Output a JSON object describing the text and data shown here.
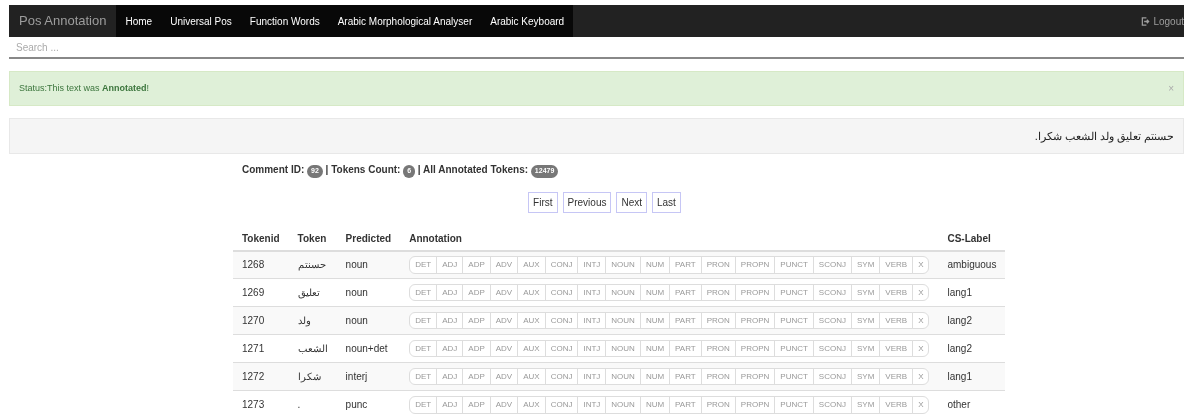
{
  "navbar": {
    "brand": "Pos Annotation",
    "links": [
      {
        "label": "Home"
      },
      {
        "label": "Universal Pos"
      },
      {
        "label": "Function Words"
      },
      {
        "label": "Arabic Morphological Analyser"
      },
      {
        "label": "Arabic Keyboard"
      }
    ],
    "logout": "Logout"
  },
  "search": {
    "placeholder": "Search ..."
  },
  "alert": {
    "text": "Status:This text was **Annotated**!",
    "close": "×"
  },
  "sentence": "حسنتم تعليق ولد الشعب شكرا.",
  "stats": [
    {
      "label": "Comment ID:",
      "value": "92"
    },
    {
      "label": "Tokens Count:",
      "value": "6"
    },
    {
      "label": "All Annotated Tokens:",
      "value": "12479"
    }
  ],
  "separator": "|",
  "pagination": [
    "First",
    "Previous",
    "Next",
    "Last"
  ],
  "table": {
    "columns": [
      "Tokenid",
      "Token",
      "Predicted",
      "Annotation",
      "CS-Label"
    ],
    "rows": [
      {
        "tokenid": "1268",
        "token": "حسنتم",
        "predicted": "noun",
        "tags": [
          {
            "label": "DET",
            "selected": false
          },
          {
            "label": "ADJ",
            "selected": false
          },
          {
            "label": "ADP",
            "selected": false
          },
          {
            "label": "ADV",
            "selected": false
          },
          {
            "label": "AUX",
            "selected": false
          },
          {
            "label": "CONJ",
            "selected": false
          },
          {
            "label": "INTJ",
            "selected": false
          },
          {
            "label": "NOUN",
            "selected": false
          },
          {
            "label": "NUM",
            "selected": false
          },
          {
            "label": "PART",
            "selected": false
          },
          {
            "label": "PRON",
            "selected": false
          },
          {
            "label": "PROPN",
            "selected": false
          },
          {
            "label": "PUNCT",
            "selected": false
          },
          {
            "label": "SCONJ",
            "selected": false
          },
          {
            "label": "SYM",
            "selected": false
          },
          {
            "label": "VERB",
            "selected": false
          },
          {
            "label": "X",
            "selected": false
          }
        ],
        "cs_label": "ambiguous"
      },
      {
        "tokenid": "1269",
        "token": "تعليق",
        "predicted": "noun",
        "tags": [
          {
            "label": "DET",
            "selected": false
          },
          {
            "label": "ADJ",
            "selected": false
          },
          {
            "label": "ADP",
            "selected": false
          },
          {
            "label": "ADV",
            "selected": false
          },
          {
            "label": "AUX",
            "selected": false
          },
          {
            "label": "CONJ",
            "selected": false
          },
          {
            "label": "INTJ",
            "selected": false
          },
          {
            "label": "NOUN",
            "selected": false
          },
          {
            "label": "NUM",
            "selected": false
          },
          {
            "label": "PART",
            "selected": false
          },
          {
            "label": "PRON",
            "selected": false
          },
          {
            "label": "PROPN",
            "selected": false
          },
          {
            "label": "PUNCT",
            "selected": false
          },
          {
            "label": "SCONJ",
            "selected": false
          },
          {
            "label": "SYM",
            "selected": false
          },
          {
            "label": "VERB",
            "selected": false
          },
          {
            "label": "X",
            "selected": false
          }
        ],
        "cs_label": "lang1"
      },
      {
        "tokenid": "1270",
        "token": "ولد",
        "predicted": "noun",
        "tags": [
          {
            "label": "DET",
            "selected": false
          },
          {
            "label": "ADJ",
            "selected": false
          },
          {
            "label": "ADP",
            "selected": false
          },
          {
            "label": "ADV",
            "selected": false
          },
          {
            "label": "AUX",
            "selected": false
          },
          {
            "label": "CONJ",
            "selected": false
          },
          {
            "label": "INTJ",
            "selected": false
          },
          {
            "label": "NOUN",
            "selected": false
          },
          {
            "label": "NUM",
            "selected": false
          },
          {
            "label": "PART",
            "selected": false
          },
          {
            "label": "PRON",
            "selected": false
          },
          {
            "label": "PROPN",
            "selected": false
          },
          {
            "label": "PUNCT",
            "selected": false
          },
          {
            "label": "SCONJ",
            "selected": false
          },
          {
            "label": "SYM",
            "selected": false
          },
          {
            "label": "VERB",
            "selected": false
          },
          {
            "label": "X",
            "selected": false
          }
        ],
        "cs_label": "lang2"
      },
      {
        "tokenid": "1271",
        "token": "الشعب",
        "predicted": "noun+det",
        "tags": [
          {
            "label": "DET",
            "selected": false
          },
          {
            "label": "ADJ",
            "selected": false
          },
          {
            "label": "ADP",
            "selected": false
          },
          {
            "label": "ADV",
            "selected": false
          },
          {
            "label": "AUX",
            "selected": false
          },
          {
            "label": "CONJ",
            "selected": false
          },
          {
            "label": "INTJ",
            "selected": false
          },
          {
            "label": "NOUN",
            "selected": false
          },
          {
            "label": "NUM",
            "selected": false
          },
          {
            "label": "PART",
            "selected": false
          },
          {
            "label": "PRON",
            "selected": false
          },
          {
            "label": "PROPN",
            "selected": false
          },
          {
            "label": "PUNCT",
            "selected": false
          },
          {
            "label": "SCONJ",
            "selected": false
          },
          {
            "label": "SYM",
            "selected": false
          },
          {
            "label": "VERB",
            "selected": false
          },
          {
            "label": "X",
            "selected": false
          }
        ],
        "cs_label": "lang2"
      },
      {
        "tokenid": "1272",
        "token": "شكرا",
        "predicted": "interj",
        "tags": [
          {
            "label": "DET",
            "selected": false
          },
          {
            "label": "ADJ",
            "selected": false
          },
          {
            "label": "ADP",
            "selected": false
          },
          {
            "label": "ADV",
            "selected": false
          },
          {
            "label": "AUX",
            "selected": false
          },
          {
            "label": "CONJ",
            "selected": false
          },
          {
            "label": "INTJ",
            "selected": false
          },
          {
            "label": "NOUN",
            "selected": false
          },
          {
            "label": "NUM",
            "selected": false
          },
          {
            "label": "PART",
            "selected": false
          },
          {
            "label": "PRON",
            "selected": false
          },
          {
            "label": "PROPN",
            "selected": false
          },
          {
            "label": "PUNCT",
            "selected": false
          },
          {
            "label": "SCONJ",
            "selected": false
          },
          {
            "label": "SYM",
            "selected": false
          },
          {
            "label": "VERB",
            "selected": false
          },
          {
            "label": "X",
            "selected": false
          }
        ],
        "cs_label": "lang1"
      },
      {
        "tokenid": "1273",
        "token": ".",
        "predicted": "punc",
        "tags": [
          {
            "label": "DET",
            "selected": false
          },
          {
            "label": "ADJ",
            "selected": false
          },
          {
            "label": "ADP",
            "selected": false
          },
          {
            "label": "ADV",
            "selected": false
          },
          {
            "label": "AUX",
            "selected": false
          },
          {
            "label": "CONJ",
            "selected": false
          },
          {
            "label": "INTJ",
            "selected": false
          },
          {
            "label": "NOUN",
            "selected": false
          },
          {
            "label": "NUM",
            "selected": false
          },
          {
            "label": "PART",
            "selected": false
          },
          {
            "label": "PRON",
            "selected": false
          },
          {
            "label": "PROPN",
            "selected": false
          },
          {
            "label": "PUNCT",
            "selected": false
          },
          {
            "label": "SCONJ",
            "selected": false
          },
          {
            "label": "SYM",
            "selected": false
          },
          {
            "label": "VERB",
            "selected": false
          },
          {
            "label": "X",
            "selected": false
          }
        ],
        "cs_label": "other"
      }
    ]
  }
}
